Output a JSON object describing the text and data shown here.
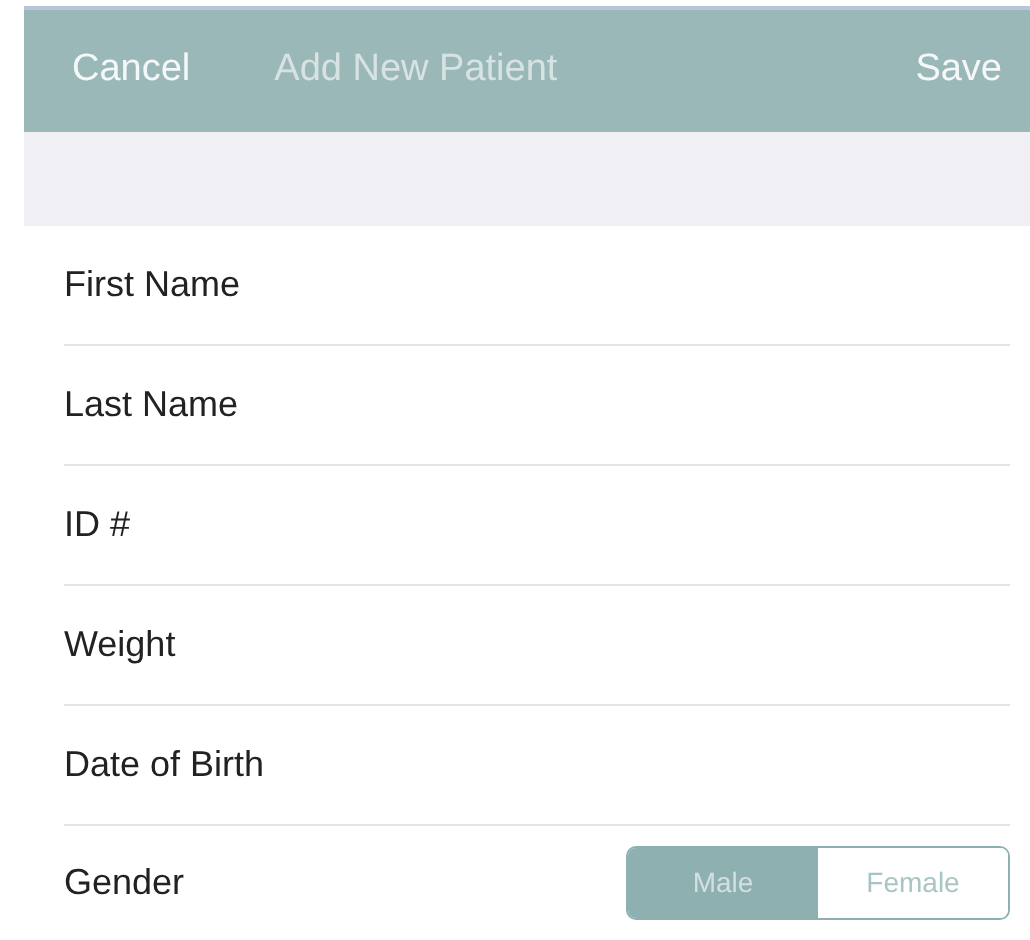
{
  "nav": {
    "cancel": "Cancel",
    "title": "Add New Patient",
    "save": "Save"
  },
  "fields": [
    {
      "label": "First Name"
    },
    {
      "label": "Last Name"
    },
    {
      "label": "ID #"
    },
    {
      "label": "Weight"
    },
    {
      "label": "Date of Birth"
    }
  ],
  "gender": {
    "label": "Gender",
    "options": [
      {
        "label": "Male",
        "selected": true
      },
      {
        "label": "Female",
        "selected": false
      }
    ]
  }
}
